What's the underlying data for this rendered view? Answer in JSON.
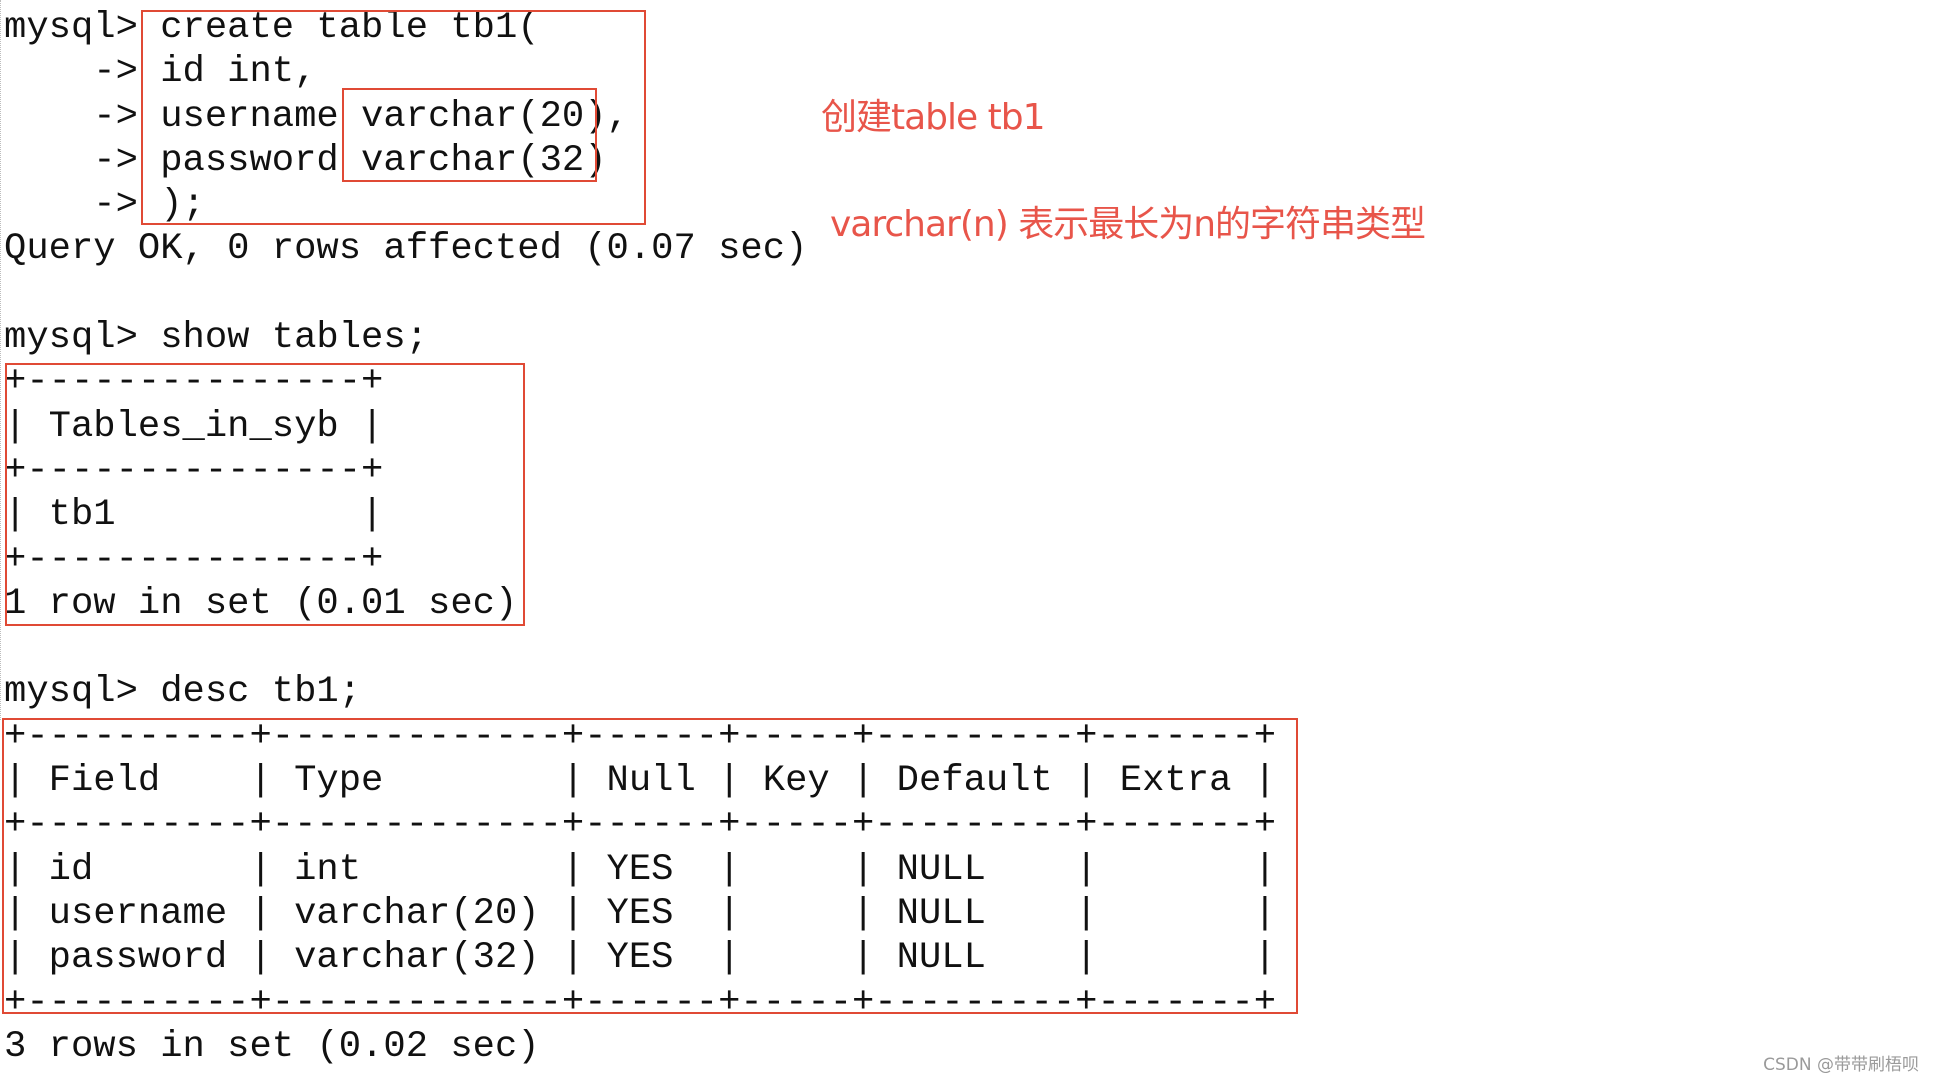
{
  "terminal": {
    "lines": [
      "mysql> create table tb1(",
      "    -> id int,",
      "    -> username varchar(20),",
      "    -> password varchar(32)",
      "    -> );",
      "Query OK, 0 rows affected (0.07 sec)",
      "",
      "mysql> show tables;",
      "+---------------+",
      "| Tables_in_syb |",
      "+---------------+",
      "| tb1           |",
      "+---------------+",
      "1 row in set (0.01 sec)",
      "",
      "mysql> desc tb1;",
      "+----------+-------------+------+-----+---------+-------+",
      "| Field    | Type        | Null | Key | Default | Extra |",
      "+----------+-------------+------+-----+---------+-------+",
      "| id       | int         | YES  |     | NULL    |       |",
      "| username | varchar(20) | YES  |     | NULL    |       |",
      "| password | varchar(32) | YES  |     | NULL    |       |",
      "+----------+-------------+------+-----+---------+-------+",
      "3 rows in set (0.02 sec)"
    ],
    "commands": {
      "create": "create table tb1( id int, username varchar(20), password varchar(32) );",
      "show": "show tables;",
      "desc": "desc tb1;"
    },
    "show_tables_result": {
      "columns": [
        "Tables_in_syb"
      ],
      "rows": [
        [
          "tb1"
        ]
      ],
      "status": "1 row in set (0.01 sec)"
    },
    "desc_result": {
      "columns": [
        "Field",
        "Type",
        "Null",
        "Key",
        "Default",
        "Extra"
      ],
      "rows": [
        [
          "id",
          "int",
          "YES",
          "",
          "NULL",
          ""
        ],
        [
          "username",
          "varchar(20)",
          "YES",
          "",
          "NULL",
          ""
        ],
        [
          "password",
          "varchar(32)",
          "YES",
          "",
          "NULL",
          ""
        ]
      ],
      "status": "3 rows in set (0.02 sec)"
    },
    "create_status": "Query OK, 0 rows affected (0.07 sec)"
  },
  "annotations": {
    "note_create": "创建table tb1",
    "note_varchar": "varchar(n) 表示最长为n的字符串类型",
    "highlight_color": "#e04a35",
    "text_color": "#e8554a"
  },
  "watermark": "CSDN @带带刷梧呗"
}
